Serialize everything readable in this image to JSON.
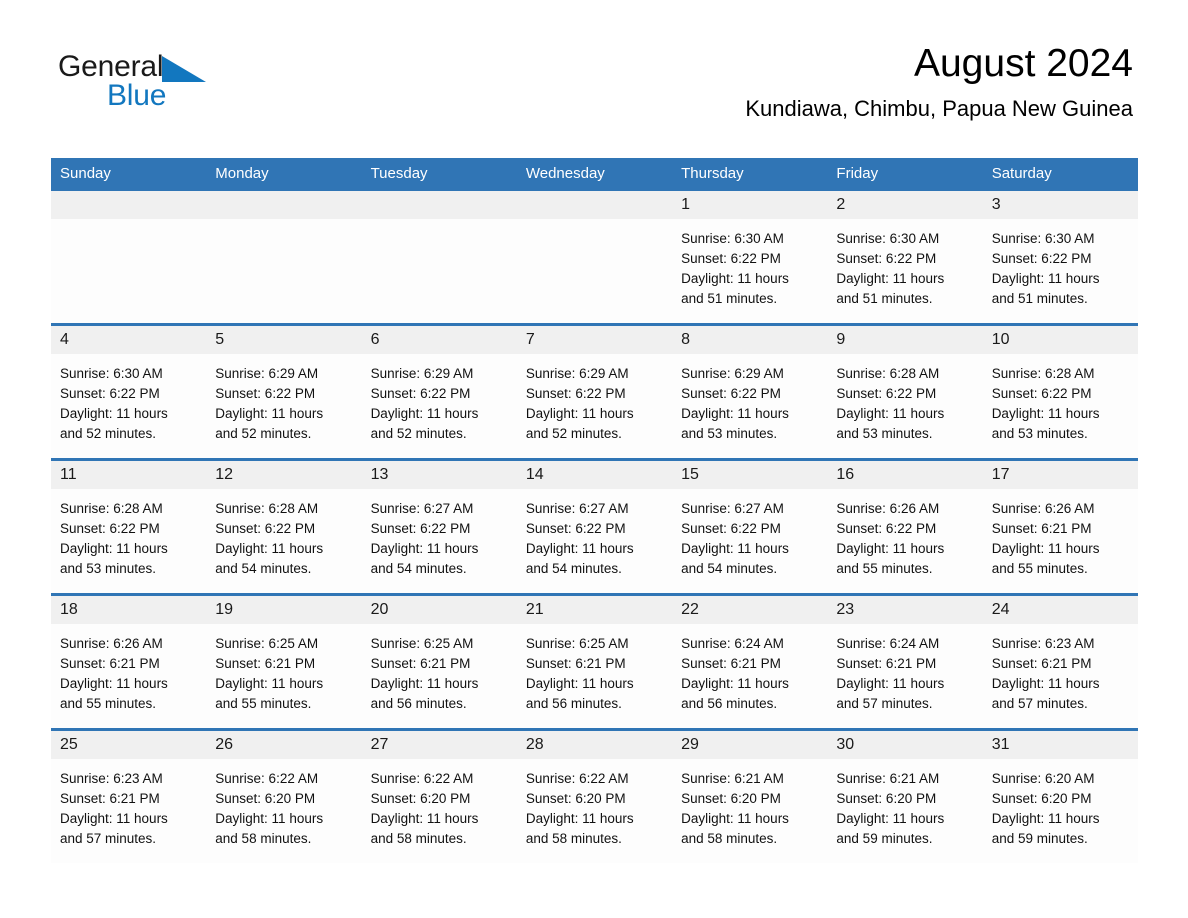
{
  "brand": {
    "name_part1": "General",
    "name_part2": "Blue",
    "triangle_icon": "brand-triangle-icon",
    "accent_color": "#1277bf"
  },
  "header": {
    "title": "August 2024",
    "subtitle": "Kundiawa, Chimbu, Papua New Guinea"
  },
  "colors": {
    "header_blue": "#3075b5",
    "row_divider_blue": "#3075b5",
    "number_band_gray": "#f0f0f0",
    "text": "#111111"
  },
  "weekdays": [
    "Sunday",
    "Monday",
    "Tuesday",
    "Wednesday",
    "Thursday",
    "Friday",
    "Saturday"
  ],
  "weeks": [
    {
      "days": [
        {
          "number": "",
          "empty": true
        },
        {
          "number": "",
          "empty": true
        },
        {
          "number": "",
          "empty": true
        },
        {
          "number": "",
          "empty": true
        },
        {
          "number": "1",
          "sunrise": "Sunrise: 6:30 AM",
          "sunset": "Sunset: 6:22 PM",
          "daylight_line1": "Daylight: 11 hours",
          "daylight_line2": "and 51 minutes."
        },
        {
          "number": "2",
          "sunrise": "Sunrise: 6:30 AM",
          "sunset": "Sunset: 6:22 PM",
          "daylight_line1": "Daylight: 11 hours",
          "daylight_line2": "and 51 minutes."
        },
        {
          "number": "3",
          "sunrise": "Sunrise: 6:30 AM",
          "sunset": "Sunset: 6:22 PM",
          "daylight_line1": "Daylight: 11 hours",
          "daylight_line2": "and 51 minutes."
        }
      ]
    },
    {
      "days": [
        {
          "number": "4",
          "sunrise": "Sunrise: 6:30 AM",
          "sunset": "Sunset: 6:22 PM",
          "daylight_line1": "Daylight: 11 hours",
          "daylight_line2": "and 52 minutes."
        },
        {
          "number": "5",
          "sunrise": "Sunrise: 6:29 AM",
          "sunset": "Sunset: 6:22 PM",
          "daylight_line1": "Daylight: 11 hours",
          "daylight_line2": "and 52 minutes."
        },
        {
          "number": "6",
          "sunrise": "Sunrise: 6:29 AM",
          "sunset": "Sunset: 6:22 PM",
          "daylight_line1": "Daylight: 11 hours",
          "daylight_line2": "and 52 minutes."
        },
        {
          "number": "7",
          "sunrise": "Sunrise: 6:29 AM",
          "sunset": "Sunset: 6:22 PM",
          "daylight_line1": "Daylight: 11 hours",
          "daylight_line2": "and 52 minutes."
        },
        {
          "number": "8",
          "sunrise": "Sunrise: 6:29 AM",
          "sunset": "Sunset: 6:22 PM",
          "daylight_line1": "Daylight: 11 hours",
          "daylight_line2": "and 53 minutes."
        },
        {
          "number": "9",
          "sunrise": "Sunrise: 6:28 AM",
          "sunset": "Sunset: 6:22 PM",
          "daylight_line1": "Daylight: 11 hours",
          "daylight_line2": "and 53 minutes."
        },
        {
          "number": "10",
          "sunrise": "Sunrise: 6:28 AM",
          "sunset": "Sunset: 6:22 PM",
          "daylight_line1": "Daylight: 11 hours",
          "daylight_line2": "and 53 minutes."
        }
      ]
    },
    {
      "days": [
        {
          "number": "11",
          "sunrise": "Sunrise: 6:28 AM",
          "sunset": "Sunset: 6:22 PM",
          "daylight_line1": "Daylight: 11 hours",
          "daylight_line2": "and 53 minutes."
        },
        {
          "number": "12",
          "sunrise": "Sunrise: 6:28 AM",
          "sunset": "Sunset: 6:22 PM",
          "daylight_line1": "Daylight: 11 hours",
          "daylight_line2": "and 54 minutes."
        },
        {
          "number": "13",
          "sunrise": "Sunrise: 6:27 AM",
          "sunset": "Sunset: 6:22 PM",
          "daylight_line1": "Daylight: 11 hours",
          "daylight_line2": "and 54 minutes."
        },
        {
          "number": "14",
          "sunrise": "Sunrise: 6:27 AM",
          "sunset": "Sunset: 6:22 PM",
          "daylight_line1": "Daylight: 11 hours",
          "daylight_line2": "and 54 minutes."
        },
        {
          "number": "15",
          "sunrise": "Sunrise: 6:27 AM",
          "sunset": "Sunset: 6:22 PM",
          "daylight_line1": "Daylight: 11 hours",
          "daylight_line2": "and 54 minutes."
        },
        {
          "number": "16",
          "sunrise": "Sunrise: 6:26 AM",
          "sunset": "Sunset: 6:22 PM",
          "daylight_line1": "Daylight: 11 hours",
          "daylight_line2": "and 55 minutes."
        },
        {
          "number": "17",
          "sunrise": "Sunrise: 6:26 AM",
          "sunset": "Sunset: 6:21 PM",
          "daylight_line1": "Daylight: 11 hours",
          "daylight_line2": "and 55 minutes."
        }
      ]
    },
    {
      "days": [
        {
          "number": "18",
          "sunrise": "Sunrise: 6:26 AM",
          "sunset": "Sunset: 6:21 PM",
          "daylight_line1": "Daylight: 11 hours",
          "daylight_line2": "and 55 minutes."
        },
        {
          "number": "19",
          "sunrise": "Sunrise: 6:25 AM",
          "sunset": "Sunset: 6:21 PM",
          "daylight_line1": "Daylight: 11 hours",
          "daylight_line2": "and 55 minutes."
        },
        {
          "number": "20",
          "sunrise": "Sunrise: 6:25 AM",
          "sunset": "Sunset: 6:21 PM",
          "daylight_line1": "Daylight: 11 hours",
          "daylight_line2": "and 56 minutes."
        },
        {
          "number": "21",
          "sunrise": "Sunrise: 6:25 AM",
          "sunset": "Sunset: 6:21 PM",
          "daylight_line1": "Daylight: 11 hours",
          "daylight_line2": "and 56 minutes."
        },
        {
          "number": "22",
          "sunrise": "Sunrise: 6:24 AM",
          "sunset": "Sunset: 6:21 PM",
          "daylight_line1": "Daylight: 11 hours",
          "daylight_line2": "and 56 minutes."
        },
        {
          "number": "23",
          "sunrise": "Sunrise: 6:24 AM",
          "sunset": "Sunset: 6:21 PM",
          "daylight_line1": "Daylight: 11 hours",
          "daylight_line2": "and 57 minutes."
        },
        {
          "number": "24",
          "sunrise": "Sunrise: 6:23 AM",
          "sunset": "Sunset: 6:21 PM",
          "daylight_line1": "Daylight: 11 hours",
          "daylight_line2": "and 57 minutes."
        }
      ]
    },
    {
      "days": [
        {
          "number": "25",
          "sunrise": "Sunrise: 6:23 AM",
          "sunset": "Sunset: 6:21 PM",
          "daylight_line1": "Daylight: 11 hours",
          "daylight_line2": "and 57 minutes."
        },
        {
          "number": "26",
          "sunrise": "Sunrise: 6:22 AM",
          "sunset": "Sunset: 6:20 PM",
          "daylight_line1": "Daylight: 11 hours",
          "daylight_line2": "and 58 minutes."
        },
        {
          "number": "27",
          "sunrise": "Sunrise: 6:22 AM",
          "sunset": "Sunset: 6:20 PM",
          "daylight_line1": "Daylight: 11 hours",
          "daylight_line2": "and 58 minutes."
        },
        {
          "number": "28",
          "sunrise": "Sunrise: 6:22 AM",
          "sunset": "Sunset: 6:20 PM",
          "daylight_line1": "Daylight: 11 hours",
          "daylight_line2": "and 58 minutes."
        },
        {
          "number": "29",
          "sunrise": "Sunrise: 6:21 AM",
          "sunset": "Sunset: 6:20 PM",
          "daylight_line1": "Daylight: 11 hours",
          "daylight_line2": "and 58 minutes."
        },
        {
          "number": "30",
          "sunrise": "Sunrise: 6:21 AM",
          "sunset": "Sunset: 6:20 PM",
          "daylight_line1": "Daylight: 11 hours",
          "daylight_line2": "and 59 minutes."
        },
        {
          "number": "31",
          "sunrise": "Sunrise: 6:20 AM",
          "sunset": "Sunset: 6:20 PM",
          "daylight_line1": "Daylight: 11 hours",
          "daylight_line2": "and 59 minutes."
        }
      ]
    }
  ]
}
